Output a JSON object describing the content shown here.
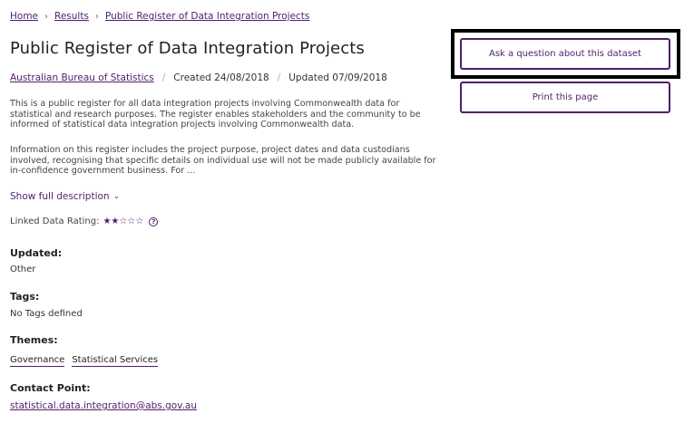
{
  "breadcrumb": {
    "items": [
      "Home",
      "Results",
      "Public Register of Data Integration Projects"
    ],
    "separator": "›"
  },
  "page_title": "Public Register of Data Integration Projects",
  "meta": {
    "publisher": "Australian Bureau of Statistics",
    "created": "Created 24/08/2018",
    "updated": "Updated 07/09/2018",
    "separator": "/"
  },
  "description": {
    "paragraph1": "This is a public register for all data integration projects involving Commonwealth data for statistical and research purposes. The register enables stakeholders and the community to be informed of statistical data integration projects involving Commonwealth data.",
    "paragraph2": "Information on this register includes the project purpose, project dates and data custodians involved, recognising that specific details on individual use will not be made publicly available for in-confidence government business. For ..."
  },
  "show_full_description": "Show full description",
  "linked_data_rating": {
    "label": "Linked Data Rating:",
    "stars_display": "★★☆☆☆",
    "rating": 2,
    "max": 5,
    "help_icon": "?"
  },
  "fields": {
    "updated": {
      "label": "Updated:",
      "value": "Other"
    },
    "tags": {
      "label": "Tags:",
      "value": "No Tags defined"
    },
    "themes": {
      "label": "Themes:",
      "values": [
        "Governance",
        "Statistical Services"
      ]
    },
    "contact": {
      "label": "Contact Point:",
      "value": "statistical.data.integration@abs.gov.au"
    }
  },
  "buttons": {
    "ask": "Ask a question about this dataset",
    "print": "Print this page"
  },
  "colors": {
    "accent": "#4f1f6b",
    "focus_ring": "#000000"
  }
}
